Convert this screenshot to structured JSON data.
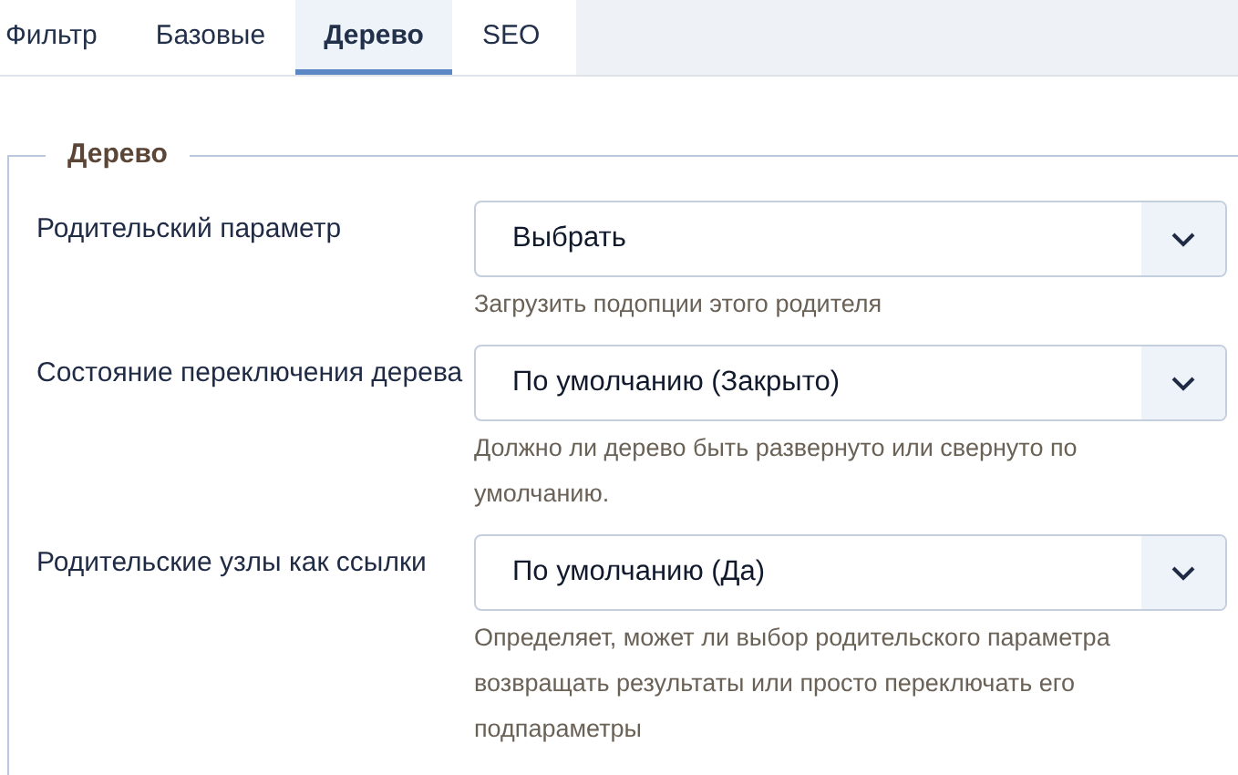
{
  "tabs": [
    {
      "label": "Фильтр",
      "selected": false
    },
    {
      "label": "Базовые",
      "selected": false
    },
    {
      "label": "Дерево",
      "selected": true
    },
    {
      "label": "SEO",
      "selected": false
    }
  ],
  "fieldset": {
    "legend": "Дерево",
    "fields": [
      {
        "label": "Родительский параметр",
        "value": "Выбрать",
        "hint": "Загрузить подопции этого родителя"
      },
      {
        "label": "Состояние переключения дерева",
        "value": "По умолчанию (Закрыто)",
        "hint": "Должно ли дерево быть развернуто или свернуто по умолчанию."
      },
      {
        "label": "Родительские узлы как ссылки",
        "value": "По умолчанию (Да)",
        "hint": "Определяет, может ли выбор родительского параметра возвращать результаты или просто переключать его подпараметры"
      }
    ]
  }
}
